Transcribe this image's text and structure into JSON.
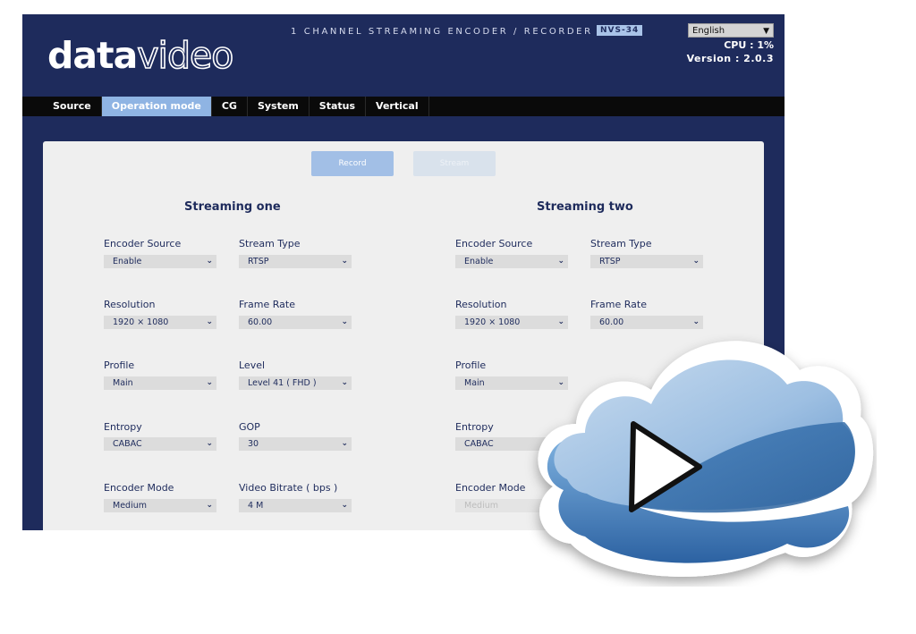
{
  "header": {
    "logo_bold": "data",
    "logo_outline": "video",
    "product_title": "1 CHANNEL STREAMING ENCODER / RECORDER",
    "model": "NVS-34",
    "language": "English",
    "cpu": "CPU  : 1%",
    "version": "Version : 2.0.3"
  },
  "nav": {
    "tabs": [
      "Source",
      "Operation mode",
      "CG",
      "System",
      "Status",
      "Vertical"
    ],
    "active": "Operation mode"
  },
  "buttons": {
    "record": "Record",
    "stream": "Stream"
  },
  "streaming_one": {
    "title": "Streaming one",
    "encoder_source": {
      "label": "Encoder Source",
      "value": "Enable"
    },
    "stream_type": {
      "label": "Stream Type",
      "value": "RTSP"
    },
    "resolution": {
      "label": "Resolution",
      "value": "1920 × 1080"
    },
    "frame_rate": {
      "label": "Frame Rate",
      "value": "60.00"
    },
    "profile": {
      "label": "Profile",
      "value": "Main"
    },
    "level": {
      "label": "Level",
      "value": "Level 41 ( FHD )"
    },
    "entropy": {
      "label": "Entropy",
      "value": "CABAC"
    },
    "gop": {
      "label": "GOP",
      "value": "30"
    },
    "encoder_mode": {
      "label": "Encoder Mode",
      "value": "Medium"
    },
    "video_bitrate": {
      "label": "Video Bitrate ( bps )",
      "value": "4 M"
    }
  },
  "streaming_two": {
    "title": "Streaming two",
    "encoder_source": {
      "label": "Encoder Source",
      "value": "Enable"
    },
    "stream_type": {
      "label": "Stream Type",
      "value": "RTSP"
    },
    "resolution": {
      "label": "Resolution",
      "value": "1920 × 1080"
    },
    "frame_rate": {
      "label": "Frame Rate",
      "value": "60.00"
    },
    "profile": {
      "label": "Profile",
      "value": "Main"
    },
    "entropy": {
      "label": "Entropy",
      "value": "CABAC"
    },
    "encoder_mode": {
      "label": "Encoder Mode",
      "value": "Medium"
    }
  },
  "icons": {
    "chevron": "chevron-down-icon",
    "cloud": "cloud-play-icon"
  },
  "colors": {
    "header_bg": "#1e2b5c",
    "active_tab": "#8fb4e3",
    "record_button": "#a2bfe6"
  }
}
